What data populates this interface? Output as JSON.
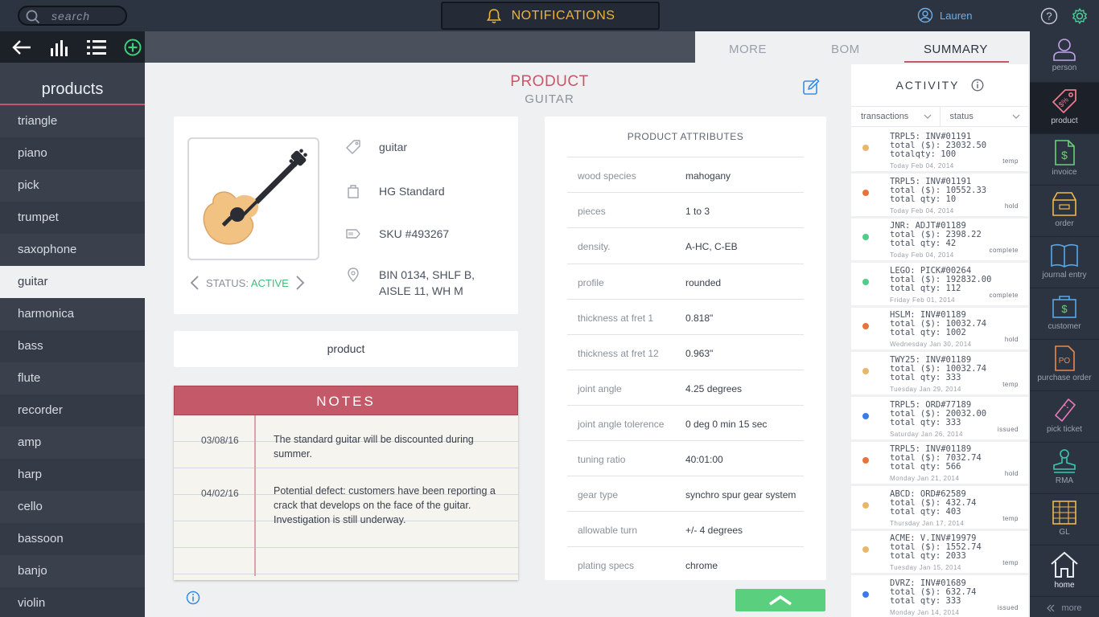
{
  "search": {
    "placeholder": "search"
  },
  "notifications": {
    "label": "NOTIFICATIONS"
  },
  "user": {
    "name": "Lauren"
  },
  "sidebar": {
    "title": "products",
    "items": [
      "triangle",
      "piano",
      "pick",
      "trumpet",
      "saxophone",
      "guitar",
      "harmonica",
      "bass",
      "flute",
      "recorder",
      "amp",
      "harp",
      "cello",
      "bassoon",
      "banjo",
      "violin"
    ],
    "active": "guitar"
  },
  "tabs": {
    "more": "MORE",
    "bom": "BOM",
    "summary": "SUMMARY"
  },
  "product": {
    "title": "PRODUCT",
    "subtitle": "GUITAR",
    "name": "guitar",
    "brand": "HG Standard",
    "sku": "SKU #493267",
    "location_line1": "BIN 0134, SHLF B,",
    "location_line2": "AISLE 11, WH M",
    "status_label": "STATUS:",
    "status_value": "ACTIVE",
    "type": "product"
  },
  "notes": {
    "title": "NOTES",
    "entries": [
      {
        "date": "03/08/16",
        "text": "The standard guitar will be discounted during summer."
      },
      {
        "date": "04/02/16",
        "text": "Potential defect: customers have been reporting a crack that develops on the face of the guitar. Investigation is still underway."
      }
    ]
  },
  "attributes": {
    "title": "PRODUCT ATTRIBUTES",
    "rows": [
      {
        "key": "wood species",
        "value": "mahogany"
      },
      {
        "key": "pieces",
        "value": "1 to 3"
      },
      {
        "key": "density.",
        "value": "A-HC, C-EB"
      },
      {
        "key": "profile",
        "value": "rounded"
      },
      {
        "key": "thickness at fret 1",
        "value": "0.818\""
      },
      {
        "key": "thickness at fret 12",
        "value": "0.963\""
      },
      {
        "key": "joint angle",
        "value": "4.25 degrees"
      },
      {
        "key": "joint angle tolerence",
        "value": "0 deg 0 min 15 sec"
      },
      {
        "key": "tuning ratio",
        "value": "40:01:00"
      },
      {
        "key": "gear type",
        "value": "synchro spur gear system"
      },
      {
        "key": "allowable turn",
        "value": "+/- 4 degrees"
      },
      {
        "key": "plating specs",
        "value": "chrome"
      }
    ]
  },
  "activity": {
    "title": "ACTIVITY",
    "filters": [
      "transactions",
      "status"
    ],
    "items": [
      {
        "l1": "TRPL5: INV#01191",
        "l2": "total ($): 23032.50",
        "l3": "totalqty: 100",
        "date": "Today Feb 04, 2014",
        "status": "temp",
        "color": "#e8b86a"
      },
      {
        "l1": "TRPL5: INV#01191",
        "l2": "total ($): 10552.33",
        "l3": "total qty: 10",
        "date": "Today Feb 04, 2014",
        "status": "hold",
        "color": "#e8743c"
      },
      {
        "l1": "JNR: ADJT#01189",
        "l2": "total ($): 2398.22",
        "l3": "total qty: 42",
        "date": "Today Feb 04, 2014",
        "status": "complete",
        "color": "#4ccf86"
      },
      {
        "l1": "LEGO: PICK#00264",
        "l2": "total ($): 192832.00",
        "l3": "total qty: 112",
        "date": "Friday Feb 01, 2014",
        "status": "complete",
        "color": "#4ccf86"
      },
      {
        "l1": "HSLM: INV#01189",
        "l2": "total ($): 10032.74",
        "l3": "total qty: 1002",
        "date": "Wednesday Jan 30, 2014",
        "status": "hold",
        "color": "#e8743c"
      },
      {
        "l1": "TWY25: INV#01189",
        "l2": "total ($): 10032.74",
        "l3": "total qty: 333",
        "date": "Tuesday Jan 29, 2014",
        "status": "temp",
        "color": "#e8b86a"
      },
      {
        "l1": "TRPL5: ORD#77189",
        "l2": "total ($): 20032.00",
        "l3": "total qty: 333",
        "date": "Saturday Jan 26, 2014",
        "status": "issued",
        "color": "#3b7de8"
      },
      {
        "l1": "TRPL5: INV#01189",
        "l2": "total ($): 7032.74",
        "l3": "total qty: 566",
        "date": "Monday Jan 21, 2014",
        "status": "hold",
        "color": "#e8743c"
      },
      {
        "l1": "ABCD: ORD#62589",
        "l2": "total ($): 432.74",
        "l3": "total qty: 403",
        "date": "Thursday Jan 17, 2014",
        "status": "temp",
        "color": "#e8b86a"
      },
      {
        "l1": "ACME: V.INV#19979",
        "l2": "total ($): 1552.74",
        "l3": "total qty: 2033",
        "date": "Tuesday Jan 15, 2014",
        "status": "temp",
        "color": "#e8b86a"
      },
      {
        "l1": "DVRZ: INV#01689",
        "l2": "total ($): 632.74",
        "l3": "total qty: 333",
        "date": "Monday Jan 14, 2014",
        "status": "issued",
        "color": "#3b7de8"
      }
    ]
  },
  "rail": {
    "items": [
      {
        "label": "person",
        "icon": "person-icon"
      },
      {
        "label": "product",
        "icon": "tag-icon"
      },
      {
        "label": "invoice",
        "icon": "invoice-icon"
      },
      {
        "label": "order",
        "icon": "box-icon"
      },
      {
        "label": "journal entry",
        "icon": "journal-icon"
      },
      {
        "label": "customer",
        "icon": "customer-icon"
      },
      {
        "label": "purchase order",
        "icon": "purchase-order-icon"
      },
      {
        "label": "pick ticket",
        "icon": "ticket-icon"
      },
      {
        "label": "RMA",
        "icon": "stamp-icon"
      },
      {
        "label": "GL",
        "icon": "ledger-icon"
      },
      {
        "label": "home",
        "icon": "home-icon"
      }
    ],
    "active": "product",
    "more": "more"
  },
  "colors": {
    "accent": "#c8566a",
    "active": "#3cbf7a",
    "notifications": "#f2b233",
    "link": "#6eaee6"
  }
}
